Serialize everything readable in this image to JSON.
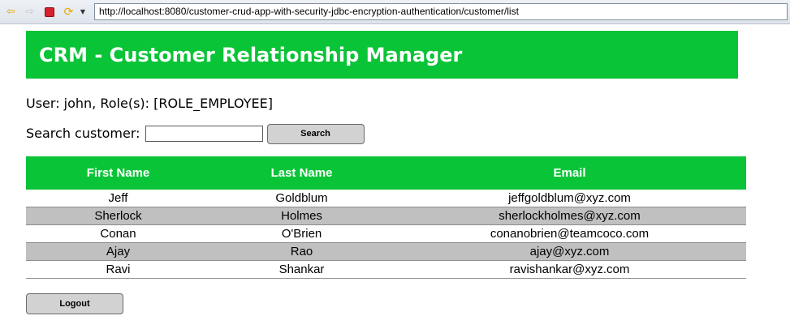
{
  "browser": {
    "url": "http://localhost:8080/customer-crud-app-with-security-jdbc-encryption-authentication/customer/list"
  },
  "header": {
    "title": "CRM - Customer Relationship Manager"
  },
  "user_info": "User: john, Role(s): [ROLE_EMPLOYEE]",
  "search": {
    "label": "Search customer:",
    "value": "",
    "button_label": "Search"
  },
  "table": {
    "columns": [
      "First Name",
      "Last Name",
      "Email"
    ],
    "rows": [
      [
        "Jeff",
        "Goldblum",
        "jeffgoldblum@xyz.com"
      ],
      [
        "Sherlock",
        "Holmes",
        "sherlockholmes@xyz.com"
      ],
      [
        "Conan",
        "O'Brien",
        "conanobrien@teamcoco.com"
      ],
      [
        "Ajay",
        "Rao",
        "ajay@xyz.com"
      ],
      [
        "Ravi",
        "Shankar",
        "ravishankar@xyz.com"
      ]
    ]
  },
  "logout": {
    "button_label": "Logout"
  },
  "colors": {
    "header_green": "#0ac437",
    "alt_row_gray": "#c0c0c0",
    "button_gray": "#d2d2d2"
  },
  "icons": {
    "back": "back-arrow-icon",
    "forward": "forward-arrow-icon",
    "stop": "stop-icon",
    "refresh": "refresh-icon",
    "menu": "dropdown-arrow-icon"
  }
}
